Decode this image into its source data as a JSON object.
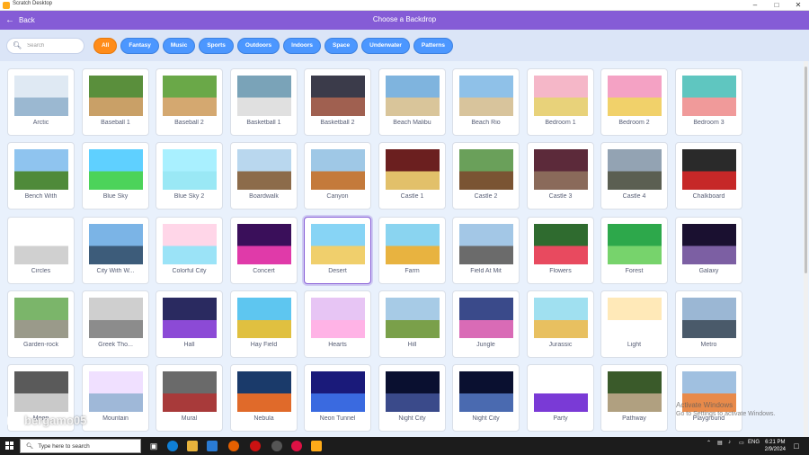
{
  "window": {
    "title": "Scratch Desktop",
    "minimize": "–",
    "maximize": "□",
    "close": "✕"
  },
  "header": {
    "back_label": "Back",
    "title": "Choose a Backdrop"
  },
  "search": {
    "placeholder": "Search"
  },
  "tags": [
    "All",
    "Fantasy",
    "Music",
    "Sports",
    "Outdoors",
    "Indoors",
    "Space",
    "Underwater",
    "Patterns"
  ],
  "active_tag": "All",
  "backdrops": [
    "Arctic",
    "Baseball 1",
    "Baseball 2",
    "Basketball 1",
    "Basketball 2",
    "Beach Malibu",
    "Beach Rio",
    "Bedroom 1",
    "Bedroom 2",
    "Bedroom 3",
    "Bench With",
    "Blue Sky",
    "Blue Sky 2",
    "Boardwalk",
    "Canyon",
    "Castle 1",
    "Castle 2",
    "Castle 3",
    "Castle 4",
    "Chalkboard",
    "Circles",
    "City With W...",
    "Colorful City",
    "Concert",
    "Desert",
    "Farm",
    "Field At Mit",
    "Flowers",
    "Forest",
    "Galaxy",
    "Garden-rock",
    "Greek Tho...",
    "Hall",
    "Hay Field",
    "Hearts",
    "Hill",
    "Jungle",
    "Jurassic",
    "Light",
    "Metro",
    "Moon",
    "Mountain",
    "Mural",
    "Nebula",
    "Neon Tunnel",
    "Night City",
    "Night City",
    "Party",
    "Pathway",
    "Playground"
  ],
  "selected_backdrop": "Desert",
  "watermark": "bergamo05",
  "activate_windows": {
    "line1": "Activate Windows",
    "line2": "Go to Settings to activate Windows."
  },
  "taskbar": {
    "search_placeholder": "Type here to search",
    "language": "ENG",
    "time": "6:21 PM",
    "date": "2/9/2024"
  },
  "colors": {
    "header": "#855cd6",
    "tag": "#4c97ff",
    "tag_active": "#ff8c1a"
  }
}
